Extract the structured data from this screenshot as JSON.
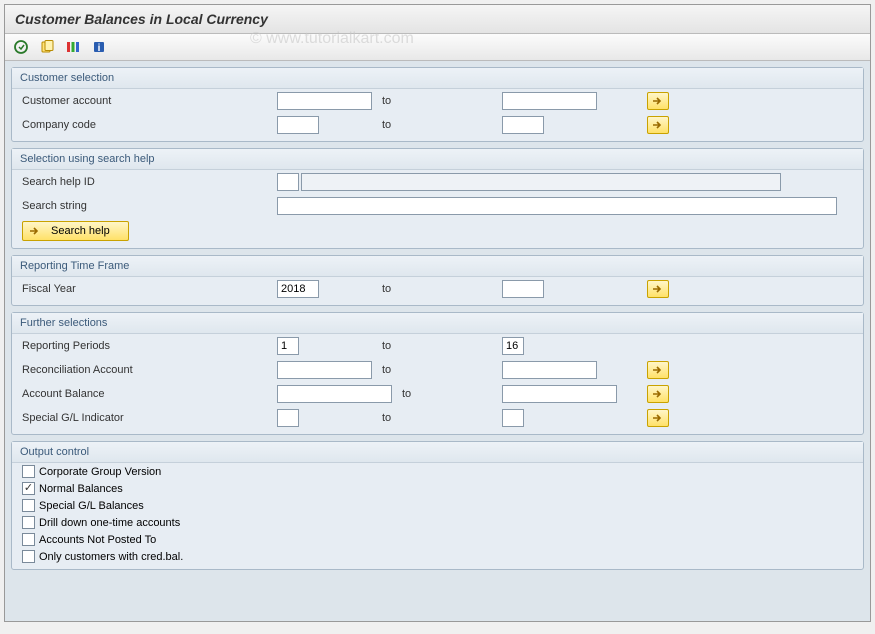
{
  "window": {
    "title": "Customer Balances in Local Currency",
    "watermark": "© www.tutorialkart.com"
  },
  "toolbar": {
    "icons": [
      "execute",
      "variant",
      "columns",
      "info"
    ]
  },
  "labels": {
    "to": "to"
  },
  "sections": {
    "customer_selection": {
      "title": "Customer selection",
      "customer_account": {
        "label": "Customer account",
        "from": "",
        "to": ""
      },
      "company_code": {
        "label": "Company code",
        "from": "",
        "to": ""
      }
    },
    "search_help": {
      "title": "Selection using search help",
      "search_help_id": {
        "label": "Search help ID",
        "id": "",
        "desc": ""
      },
      "search_string": {
        "label": "Search string",
        "value": ""
      },
      "button": "Search help"
    },
    "reporting_time_frame": {
      "title": "Reporting Time Frame",
      "fiscal_year": {
        "label": "Fiscal Year",
        "from": "2018",
        "to": ""
      }
    },
    "further_selections": {
      "title": "Further selections",
      "reporting_periods": {
        "label": "Reporting Periods",
        "from": "1",
        "to": "16"
      },
      "reconciliation_acct": {
        "label": "Reconciliation Account",
        "from": "",
        "to": ""
      },
      "account_balance": {
        "label": "Account Balance",
        "from": "",
        "to": ""
      },
      "special_gl_indicator": {
        "label": "Special G/L Indicator",
        "from": "",
        "to": ""
      }
    },
    "output_control": {
      "title": "Output control",
      "options": [
        {
          "label": "Corporate Group Version",
          "checked": false
        },
        {
          "label": "Normal Balances",
          "checked": true
        },
        {
          "label": "Special G/L Balances",
          "checked": false
        },
        {
          "label": "Drill down one-time accounts",
          "checked": false
        },
        {
          "label": "Accounts Not Posted To",
          "checked": false
        },
        {
          "label": "Only customers with cred.bal.",
          "checked": false
        }
      ]
    }
  }
}
